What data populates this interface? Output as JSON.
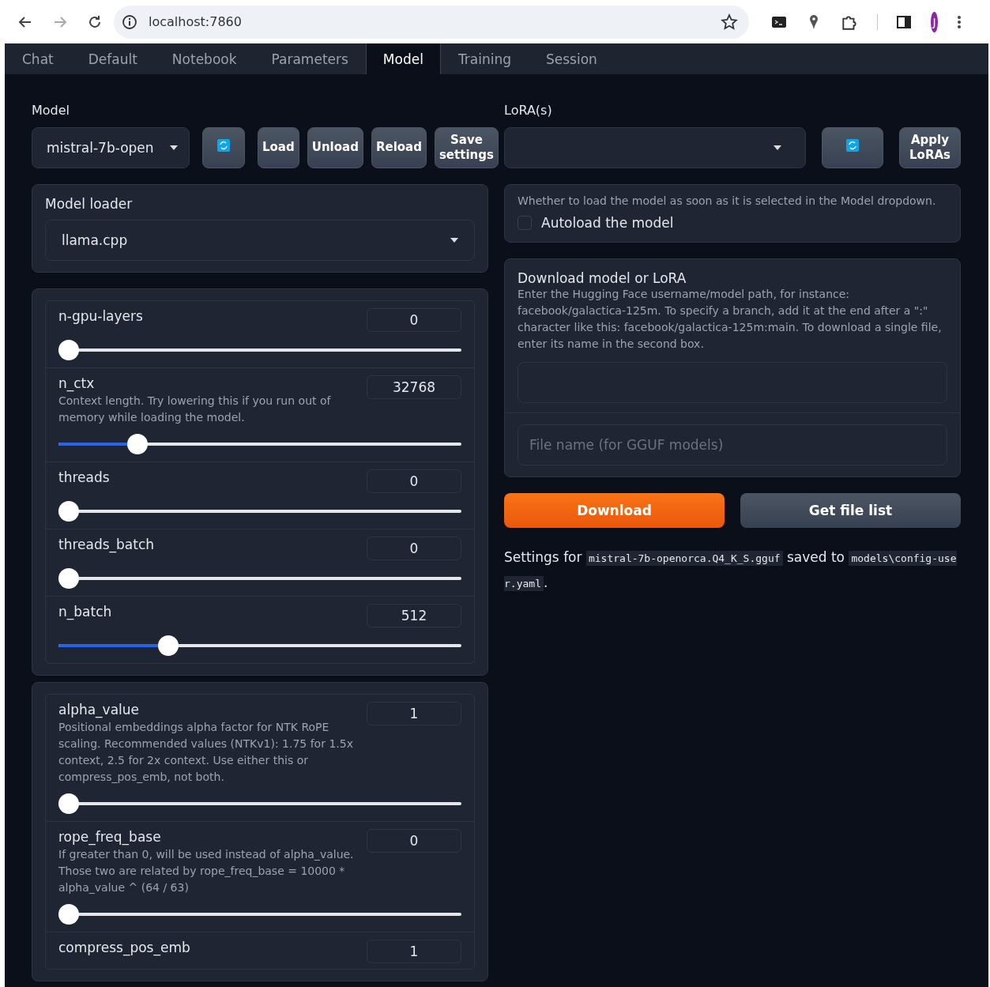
{
  "browser": {
    "url": "localhost:7860",
    "profile_initial": "J"
  },
  "tabs": [
    {
      "label": "Chat",
      "selected": false
    },
    {
      "label": "Default",
      "selected": false
    },
    {
      "label": "Notebook",
      "selected": false
    },
    {
      "label": "Parameters",
      "selected": false
    },
    {
      "label": "Model",
      "selected": true
    },
    {
      "label": "Training",
      "selected": false
    },
    {
      "label": "Session",
      "selected": false
    }
  ],
  "model": {
    "label": "Model",
    "dropdown_value": "mistral-7b-open",
    "buttons": [
      "Load",
      "Unload",
      "Reload",
      "Save settings"
    ]
  },
  "model_loader": {
    "label": "Model loader",
    "value": "llama.cpp"
  },
  "slider_groups": [
    {
      "sliders": [
        {
          "name": "n-gpu-layers",
          "value": "0",
          "level": 0
        },
        {
          "name": "n_ctx",
          "description": "Context length. Try lowering this if you run out of memory while loading the model.",
          "value": "32768",
          "level": 0.18
        },
        {
          "name": "threads",
          "value": "0",
          "level": 0
        },
        {
          "name": "threads_batch",
          "value": "0",
          "level": 0
        },
        {
          "name": "n_batch",
          "value": "512",
          "level": 0.26
        }
      ]
    },
    {
      "sliders": [
        {
          "name": "alpha_value",
          "description": "Positional embeddings alpha factor for NTK RoPE scaling. Recommended values (NTKv1): 1.75 for 1.5x context, 2.5 for 2x context. Use either this or compress_pos_emb, not both.",
          "value": "1",
          "level": 0
        },
        {
          "name": "rope_freq_base",
          "description": "If greater than 0, will be used instead of alpha_value. Those two are related by rope_freq_base = 10000 * alpha_value ^ (64 / 63)",
          "value": "0",
          "level": 0
        },
        {
          "name": "compress_pos_emb",
          "value": "1"
        }
      ]
    }
  ],
  "lora": {
    "label": "LoRA(s)",
    "apply_button": "Apply LoRAs"
  },
  "autoload": {
    "info": "Whether to load the model as soon as it is selected in the Model dropdown.",
    "label": "Autoload the model",
    "checked": false
  },
  "download": {
    "title": "Download model or LoRA",
    "description": "Enter the Hugging Face username/model path, for instance: facebook/galactica-125m. To specify a branch, add it at the end after a \":\" character like this: facebook/galactica-125m:main. To download a single file, enter its name in the second box.",
    "file_placeholder": "File name (for GGUF models)",
    "download_button": "Download",
    "file_list_button": "Get file list"
  },
  "status_message": [
    {
      "kind": "text",
      "text": "Settings for "
    },
    {
      "kind": "code",
      "text": "mistral-7b-openorca.Q4_K_S.gguf"
    },
    {
      "kind": "text",
      "text": " saved to "
    },
    {
      "kind": "code",
      "text": "models\\config-user.yaml"
    },
    {
      "kind": "text",
      "text": "."
    }
  ]
}
